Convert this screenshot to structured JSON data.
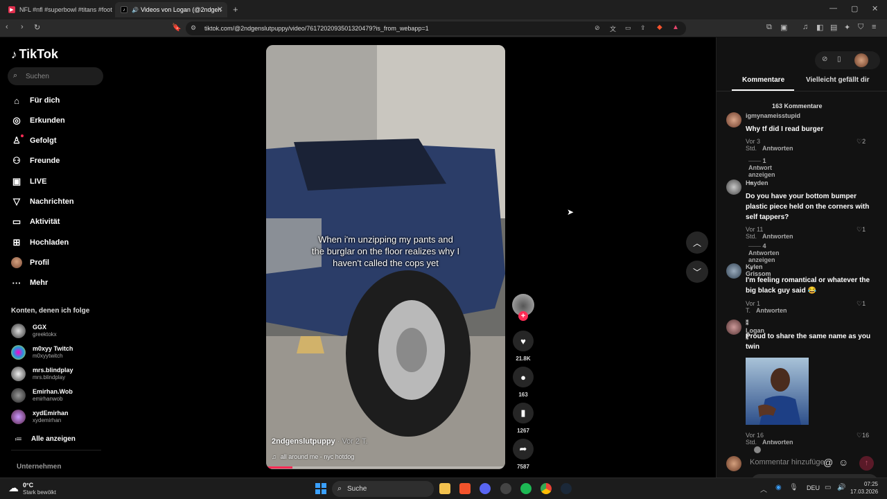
{
  "browser": {
    "tabs": [
      {
        "title": "NFL #nfl #superbowl #titans #footba"
      },
      {
        "title": "Videos von Logan (@2ndgen"
      }
    ],
    "url": "tiktok.com/@2ndgenslutpuppy/video/7617202093501320479?is_from_webapp=1"
  },
  "sidebar": {
    "logo": "TikTok",
    "search_placeholder": "Suchen",
    "nav": [
      {
        "label": "Für dich",
        "icon": "home-icon"
      },
      {
        "label": "Erkunden",
        "icon": "compass-icon"
      },
      {
        "label": "Gefolgt",
        "icon": "following-icon"
      },
      {
        "label": "Freunde",
        "icon": "friends-icon"
      },
      {
        "label": "LIVE",
        "icon": "live-icon"
      },
      {
        "label": "Nachrichten",
        "icon": "messages-icon"
      },
      {
        "label": "Aktivität",
        "icon": "activity-icon"
      },
      {
        "label": "Hochladen",
        "icon": "upload-icon"
      },
      {
        "label": "Profil",
        "icon": "profile-avatar"
      },
      {
        "label": "Mehr",
        "icon": "more-icon"
      }
    ],
    "following_title": "Konten, denen ich folge",
    "following": [
      {
        "name": "GGX",
        "handle": "greektokx"
      },
      {
        "name": "m0xyy Twitch",
        "handle": "m0xyytwitch"
      },
      {
        "name": "mrs.blindplay",
        "handle": "mrs.blindplay"
      },
      {
        "name": "Emirhan.Wob",
        "handle": "emirhanwob"
      },
      {
        "name": "xydEmirhan",
        "handle": "xydemirhan"
      }
    ],
    "show_all": "Alle anzeigen",
    "footer": "Unternehmen"
  },
  "video": {
    "caption": "When i'm unzipping my pants and the burglar on the floor realizes why I haven't called the cops yet",
    "author": "2ndgenslutpuppy",
    "age": "· Vor 2 T.",
    "music": "all around me - nyc hotdog",
    "likes": "21.8K",
    "comments": "163",
    "saves": "1267",
    "shares": "7587",
    "progress": 0.11
  },
  "comments_panel": {
    "tab_comments": "Kommentare",
    "tab_suggest": "Vielleicht gefällt dir",
    "count": "163 Kommentare",
    "items": [
      {
        "user": "igmynameisstupid",
        "text": "Why tf did I read burger",
        "time": "Vor 3 Std.",
        "reply": "Antworten",
        "likes": "2",
        "more": "1 Antwort anzeigen"
      },
      {
        "user": "Hayden",
        "text": "Do you have your bottom bumper plastic piece held on the corners with self tappers?",
        "time": "Vor 11 Std.",
        "reply": "Antworten",
        "likes": "1",
        "more": "4 Antworten anzeigen"
      },
      {
        "user": "Kylen Grissom",
        "text": "I'm feeling romantical or whatever the big black guy said 😂",
        "time": "Vor 1 T.",
        "reply": "Antworten",
        "likes": "1"
      },
      {
        "user": "⁑ Logan ⁑",
        "text": "Proud to share the same name as you twin",
        "time": "Vor 16 Std.",
        "reply": "Antworten",
        "likes": "16"
      }
    ],
    "input_placeholder": "Kommentar hinzufügen..."
  },
  "taskbar": {
    "weather_temp": "0°C",
    "weather_text": "Stark bewölkt",
    "search": "Suche",
    "lang": "DEU",
    "time": "07:25",
    "date": "17.03.2026"
  }
}
